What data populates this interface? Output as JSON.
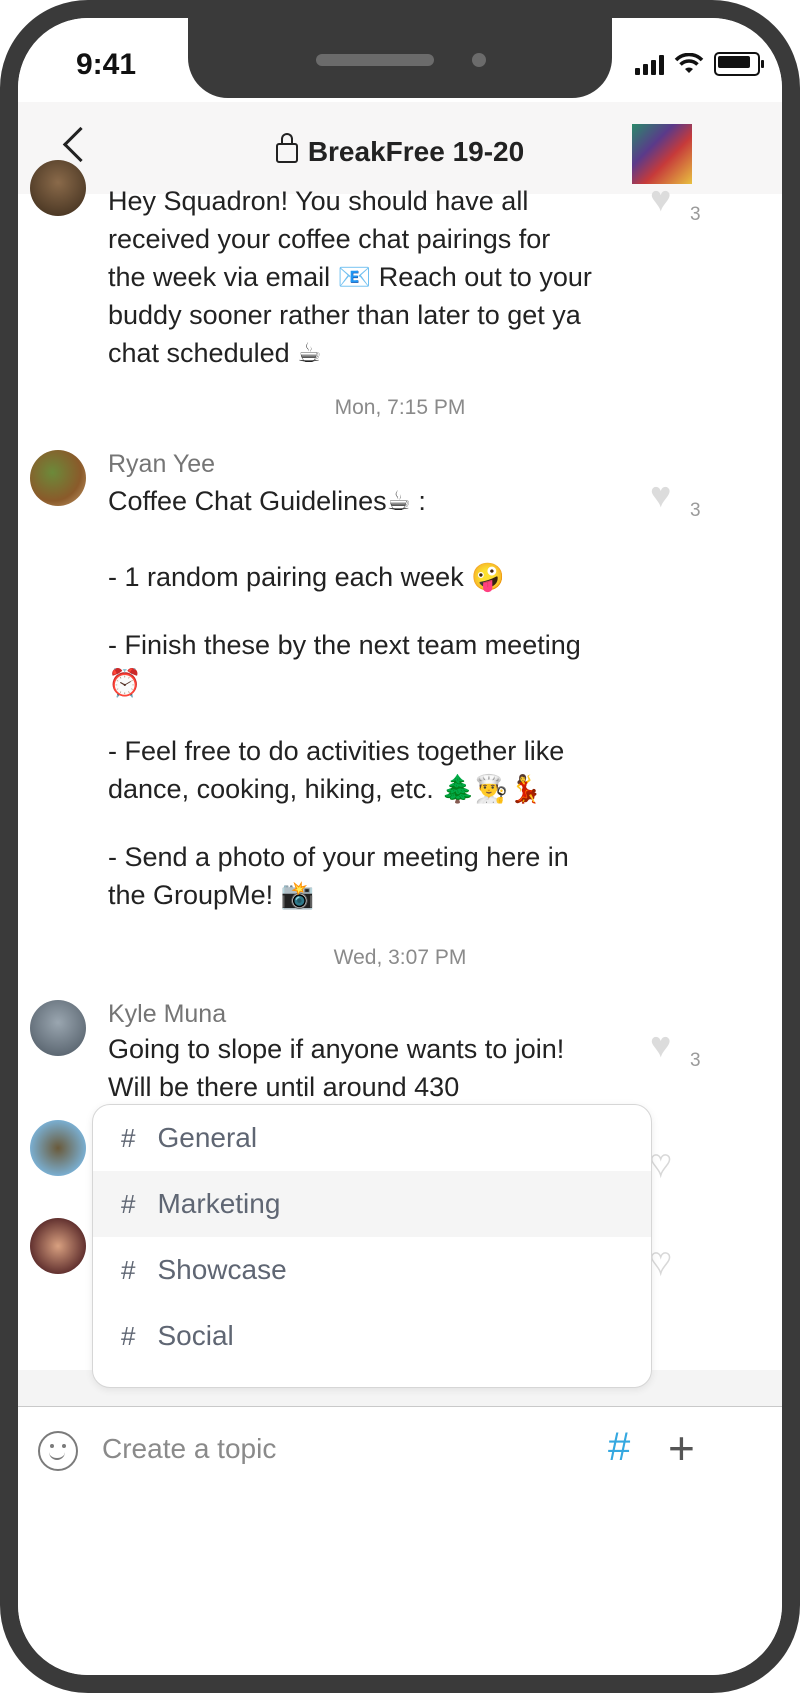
{
  "status_bar": {
    "time": "9:41"
  },
  "header": {
    "title": "BreakFree 19-20",
    "back_icon": "chevron-left-icon",
    "lock_icon": "lock-icon"
  },
  "messages": [
    {
      "lines": [
        "Hey Squadron! You should have all",
        "received your coffee chat pairings for",
        "the week via email 📧 Reach out to your",
        "buddy sooner rather than later to get ya",
        "chat scheduled ☕"
      ],
      "like_count": "3"
    },
    {
      "timestamp": "Mon, 7:15 PM",
      "author": "Ryan Yee",
      "lines": [
        "Coffee Chat Guidelines☕ :",
        "",
        "- 1 random pairing each week 🤪",
        "",
        "- Finish these by the next team meeting",
        "⏰",
        "",
        "- Feel free to do activities together like",
        "dance, cooking, hiking, etc. 🌲👨‍🍳💃",
        "",
        "- Send a photo of your meeting here in",
        "the GroupMe! 📸"
      ],
      "like_count": "3"
    },
    {
      "timestamp": "Wed, 3:07 PM",
      "author": "Kyle Muna",
      "lines": [
        "Going to slope if anyone wants to join!",
        "Will be there until around 430"
      ],
      "like_count": "3"
    }
  ],
  "topics_dropdown": {
    "items": [
      "General",
      "Marketing",
      "Showcase",
      "Social"
    ],
    "highlighted": "Marketing"
  },
  "composer": {
    "placeholder": "Create a topic",
    "hash_icon": "hashtag-icon",
    "plus_icon": "plus-icon",
    "emoji_icon": "smiley-icon"
  },
  "colors": {
    "accent": "#35a8e0",
    "frame": "#3a3a3a",
    "header_bg": "#f7f6f6"
  }
}
